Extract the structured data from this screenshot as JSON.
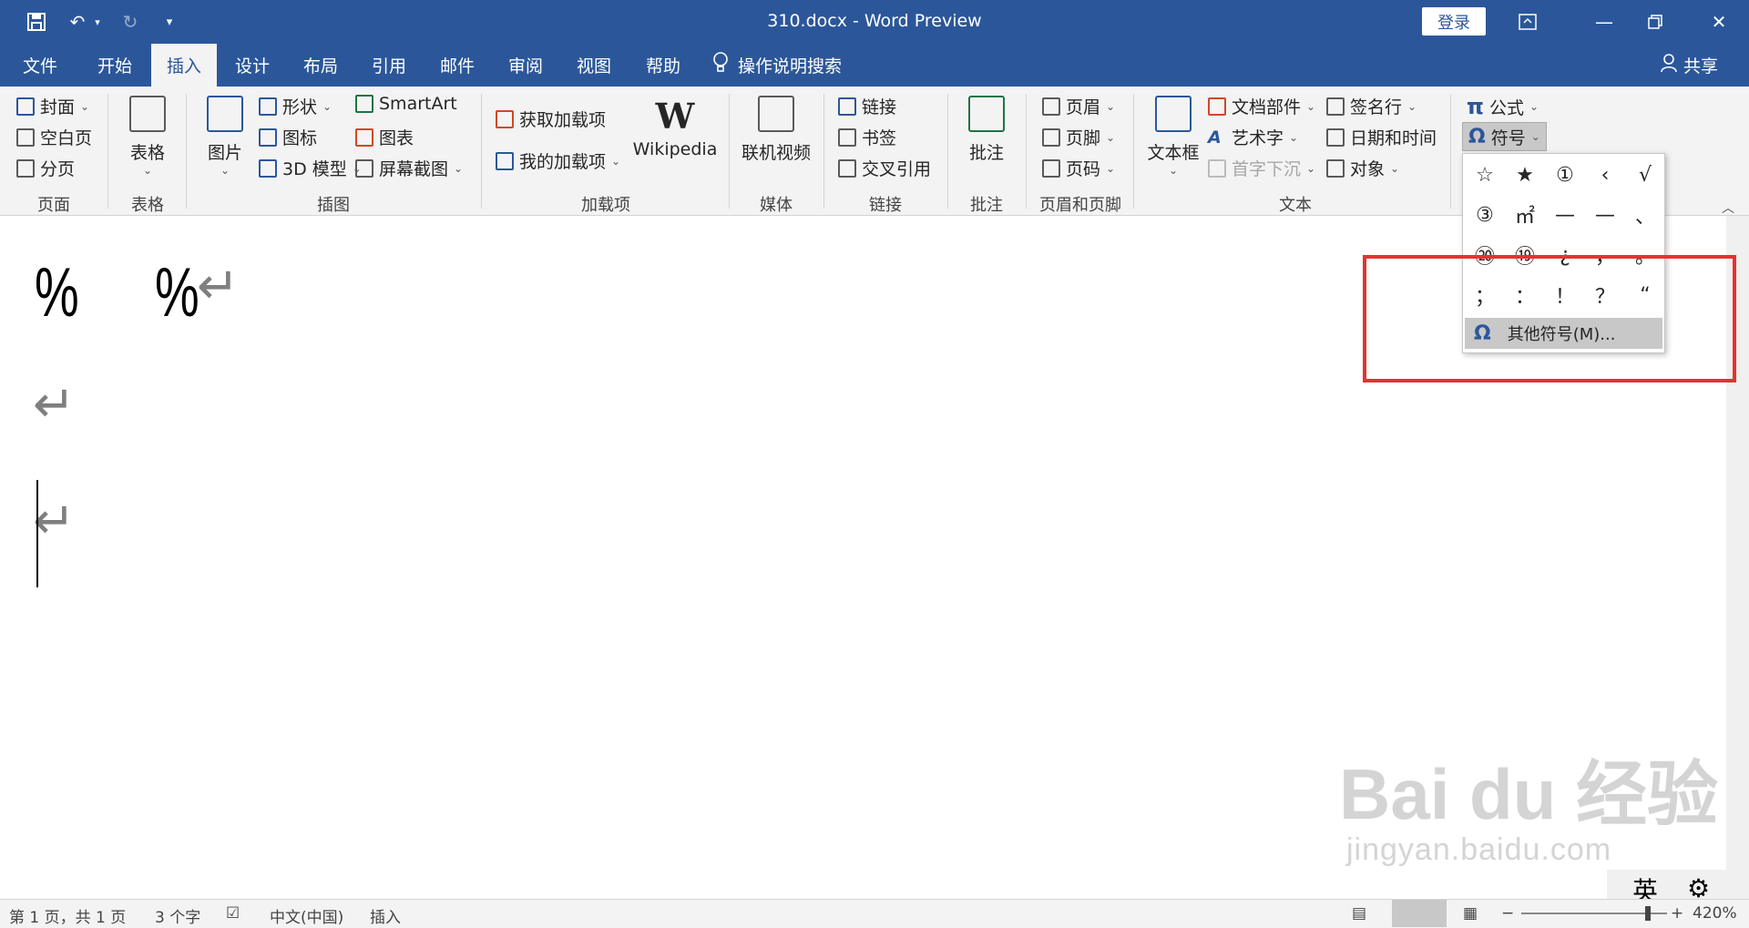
{
  "titlebar": {
    "title": "310.docx  -  Word Preview",
    "login": "登录",
    "qat": {
      "save_icon": "save-icon",
      "undo_icon": "undo-icon",
      "redo_icon": "redo-icon",
      "customize_icon": "customize-qat-icon"
    },
    "colors": {
      "brand": "#2b579a"
    }
  },
  "tabs": [
    {
      "label": "文件"
    },
    {
      "label": "开始"
    },
    {
      "label": "插入",
      "active": true
    },
    {
      "label": "设计"
    },
    {
      "label": "布局"
    },
    {
      "label": "引用"
    },
    {
      "label": "邮件"
    },
    {
      "label": "审阅"
    },
    {
      "label": "视图"
    },
    {
      "label": "帮助"
    }
  ],
  "tell_me": "操作说明搜索",
  "share": "共享",
  "ribbon": {
    "pages": {
      "cover": "封面",
      "blank": "空白页",
      "break": "分页",
      "label": "页面"
    },
    "tables": {
      "table": "表格",
      "label": "表格"
    },
    "illustrations": {
      "pictures": "图片",
      "shapes": "形状",
      "icons": "图标",
      "model3d": "3D 模型",
      "smartart": "SmartArt",
      "chart": "图表",
      "screenshot": "屏幕截图",
      "label": "插图"
    },
    "addins": {
      "get": "获取加载项",
      "my": "我的加载项",
      "wikipedia": "Wikipedia",
      "label": "加载项"
    },
    "media": {
      "online_video": "联机视频",
      "label": "媒体"
    },
    "links": {
      "link": "链接",
      "bookmark": "书签",
      "cross_ref": "交叉引用",
      "label": "链接"
    },
    "comments": {
      "comment": "批注",
      "label": "批注"
    },
    "header_footer": {
      "header": "页眉",
      "footer": "页脚",
      "page_number": "页码",
      "label": "页眉和页脚"
    },
    "text": {
      "textbox": "文本框",
      "quick_parts": "文档部件",
      "wordart": "艺术字",
      "dropcap": "首字下沉",
      "signature": "签名行",
      "datetime": "日期和时间",
      "object": "对象",
      "label": "文本"
    },
    "symbols": {
      "equation": "公式",
      "symbol": "符号"
    }
  },
  "symbol_panel": {
    "symbols": [
      "☆",
      "★",
      "①",
      "‹",
      "√",
      "③",
      "㎡",
      "—",
      "—",
      "、",
      "⑳",
      "⑲",
      "¿",
      "，",
      "。",
      "；",
      "：",
      "！",
      "？",
      "“"
    ],
    "more": "其他符号(M)..."
  },
  "document": {
    "chars": [
      "%",
      "%"
    ],
    "para_mark": "↵"
  },
  "watermark": {
    "logo": "Bai du 经验",
    "url": "jingyan.baidu.com"
  },
  "statusbar": {
    "page": "第 1 页，共 1 页",
    "words": "3 个字",
    "language": "中文(中国)",
    "mode": "插入",
    "zoom": "420%",
    "ime": "英"
  }
}
